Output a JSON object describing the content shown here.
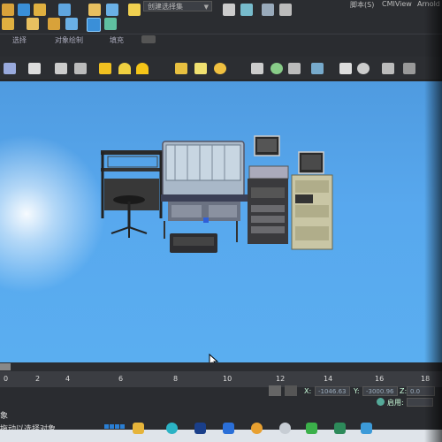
{
  "ribbon": {
    "selection_set": "创建选择集",
    "menu": [
      "脚本(S)",
      "CMIView",
      "Arnold"
    ],
    "labels": [
      "选择",
      "对象绘制",
      "填充"
    ]
  },
  "timeline": {
    "ticks": [
      "0",
      "2",
      "4",
      "6",
      "8",
      "10",
      "12",
      "14",
      "16",
      "18"
    ]
  },
  "status": {
    "x_label": "X:",
    "x_value": "-1046.63",
    "y_label": "Y:",
    "y_value": "-3000.96",
    "z_label": "Z:",
    "z_value": "0.0",
    "grid_label": "启用:",
    "hint_line1": "象",
    "hint_line2": "拖动以选择对象"
  },
  "colors": {
    "viewport": "#58a8ee",
    "ribbon": "#2b2d31",
    "accent": "#2a7fd4"
  }
}
